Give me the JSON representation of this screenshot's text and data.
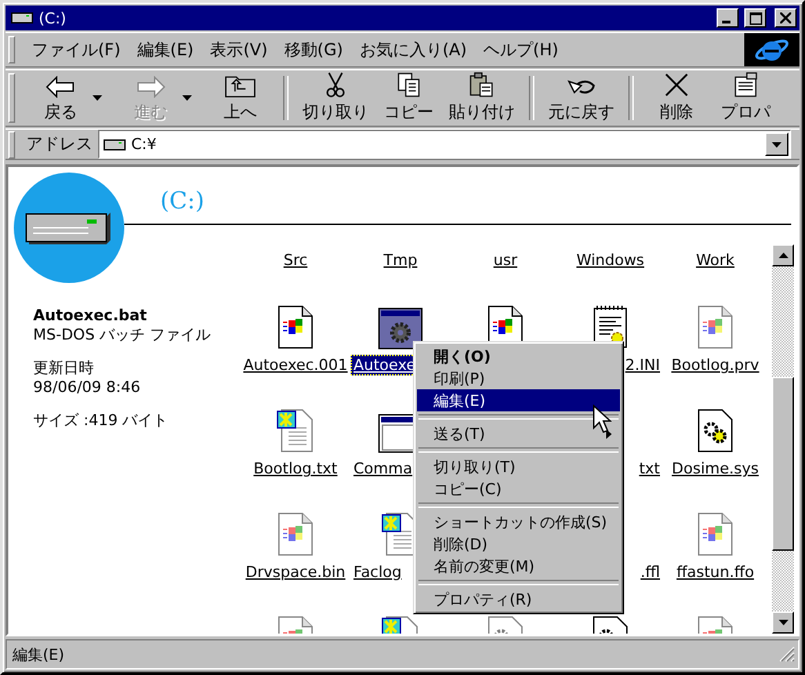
{
  "window": {
    "title": "(C:)"
  },
  "menu": [
    "ファイル(F)",
    "編集(E)",
    "表示(V)",
    "移動(G)",
    "お気に入り(A)",
    "ヘルプ(H)"
  ],
  "toolbar": [
    {
      "kind": "back",
      "label": "戻る",
      "disabled": false,
      "dropdown": true
    },
    {
      "kind": "forward",
      "label": "進む",
      "disabled": true,
      "dropdown": true
    },
    {
      "kind": "up",
      "label": "上へ",
      "disabled": false,
      "dropdown": false
    },
    {
      "kind": "separator"
    },
    {
      "kind": "cut",
      "label": "切り取り",
      "disabled": false,
      "dropdown": false
    },
    {
      "kind": "copy",
      "label": "コピー",
      "disabled": false,
      "dropdown": false
    },
    {
      "kind": "paste",
      "label": "貼り付け",
      "disabled": false,
      "dropdown": false
    },
    {
      "kind": "separator"
    },
    {
      "kind": "undo",
      "label": "元に戻す",
      "disabled": false,
      "dropdown": false
    },
    {
      "kind": "separator"
    },
    {
      "kind": "delete",
      "label": "削除",
      "disabled": false,
      "dropdown": false
    },
    {
      "kind": "properties",
      "label": "プロパ",
      "disabled": false,
      "dropdown": false
    }
  ],
  "address": {
    "label": "アドレス",
    "value": "C:¥"
  },
  "heading": "(C:)",
  "info": {
    "name": "Autoexec.bat",
    "type": "MS-DOS バッチ ファイル",
    "modified_label": "更新日時",
    "modified": "98/06/09 8:46",
    "size": "サイズ :419 バイト"
  },
  "folders": [
    "Src",
    "Tmp",
    "usr",
    "Windows",
    "Work"
  ],
  "files": [
    [
      {
        "kind": "bat",
        "label": "Autoexec.001",
        "selected": false
      },
      {
        "kind": "app",
        "label": "Autoexe",
        "selected": true
      },
      {
        "kind": "bat"
      },
      {
        "kind": "ini",
        "label": "2.INI",
        "selected": false
      },
      {
        "kind": "batfaded",
        "label": "Bootlog.prv",
        "selected": false
      }
    ],
    [
      {
        "kind": "txt",
        "label": "Bootlog.txt",
        "selected": false
      },
      {
        "kind": "window",
        "label": "Comma",
        "selected": false
      },
      {
        "kind": "hidden"
      },
      {
        "kind": "hidden",
        "label": "txt",
        "selected": false
      },
      {
        "kind": "sys",
        "label": "Dosime.sys",
        "selected": false
      }
    ],
    [
      {
        "kind": "batfaded",
        "label": "Drvspace.bin",
        "selected": false
      },
      {
        "kind": "txt",
        "label": "Faclog",
        "selected": false
      },
      {
        "kind": "hidden"
      },
      {
        "kind": "hidden",
        "label": ".ffl",
        "selected": false
      },
      {
        "kind": "batfaded",
        "label": "ffastun.ffo",
        "selected": false
      }
    ],
    [
      {
        "kind": "batfaded"
      },
      {
        "kind": "txt"
      },
      {
        "kind": "gearfaded"
      },
      {
        "kind": "sys"
      },
      {
        "kind": "batfaded"
      }
    ]
  ],
  "context_menu": [
    {
      "kind": "item",
      "label": "開く(O)",
      "default": true,
      "selected": false,
      "submenu": false
    },
    {
      "kind": "item",
      "label": "印刷(P)",
      "default": false,
      "selected": false,
      "submenu": false
    },
    {
      "kind": "item",
      "label": "編集(E)",
      "default": false,
      "selected": true,
      "submenu": false
    },
    {
      "kind": "separator"
    },
    {
      "kind": "item",
      "label": "送る(T)",
      "default": false,
      "selected": false,
      "submenu": true
    },
    {
      "kind": "separator"
    },
    {
      "kind": "item",
      "label": "切り取り(T)",
      "default": false,
      "selected": false,
      "submenu": false
    },
    {
      "kind": "item",
      "label": "コピー(C)",
      "default": false,
      "selected": false,
      "submenu": false
    },
    {
      "kind": "separator"
    },
    {
      "kind": "item",
      "label": "ショートカットの作成(S)",
      "default": false,
      "selected": false,
      "submenu": false
    },
    {
      "kind": "item",
      "label": "削除(D)",
      "default": false,
      "selected": false,
      "submenu": false
    },
    {
      "kind": "item",
      "label": "名前の変更(M)",
      "default": false,
      "selected": false,
      "submenu": false
    },
    {
      "kind": "separator"
    },
    {
      "kind": "item",
      "label": "プロパティ(R)",
      "default": false,
      "selected": false,
      "submenu": false
    }
  ],
  "status_bar": "編集(E)"
}
